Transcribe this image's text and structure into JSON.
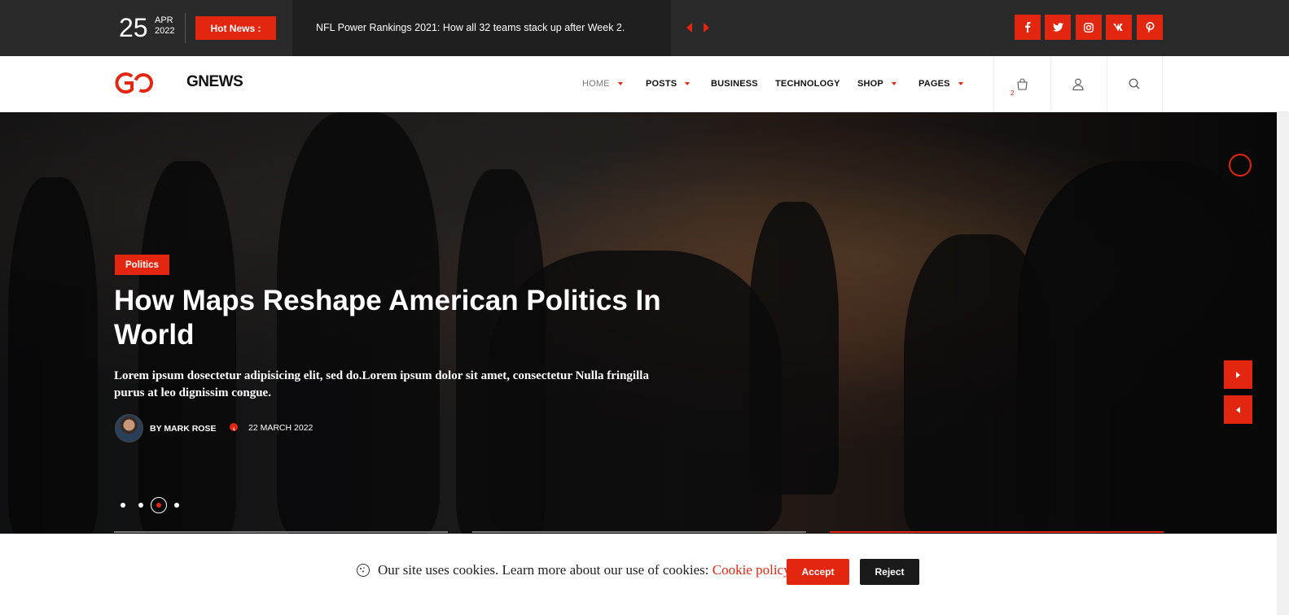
{
  "topbar": {
    "day": "25",
    "month": "APR",
    "year": "2022",
    "hot_label": "Hot News :",
    "ticker": "NFL Power Rankings 2021: How all 32 teams stack up after Week 2.",
    "social": [
      "f",
      "t",
      "ig",
      "vk",
      "p"
    ]
  },
  "header": {
    "logo_mark": "GO",
    "logo_text": "GNEWS",
    "nav": [
      "HOME",
      "POSTS",
      "BUSINESS",
      "TECHNOLOGY",
      "SHOP",
      "PAGES"
    ],
    "cart_count": "2"
  },
  "hero": {
    "category": "Politics",
    "title": "How Maps Reshape American Politics In World",
    "excerpt": "Lorem ipsum dosectetur adipisicing elit, sed do.Lorem ipsum dolor sit amet, consectetur Nulla fringilla purus at leo dignissim congue.",
    "author": "BY MARK ROSE",
    "date": "22 MARCH 2022",
    "active_slide_index": 2,
    "slide_count": 4
  },
  "cookie": {
    "text": "Our site uses cookies. Learn more about our use of cookies: ",
    "link": "Cookie policy",
    "accept": "Accept",
    "reject": "Reject"
  },
  "colors": {
    "accent": "#e3260f",
    "topbar_bg": "#2a2a2a",
    "reject_bg": "#1a1a1a"
  }
}
